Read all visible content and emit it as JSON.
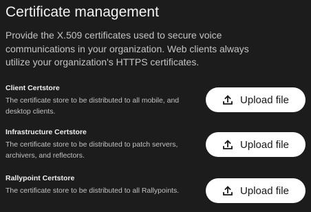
{
  "page": {
    "title": "Certificate management",
    "intro": "Provide the X.509 certificates used to secure voice communications in your organization. Web clients always utilize your organization's HTTPS certificates."
  },
  "sections": [
    {
      "title": "Client Certstore",
      "description": "The certificate store to be distributed to all mobile, and desktop clients.",
      "button_label": "Upload file",
      "button_icon": "upload-icon"
    },
    {
      "title": "Infrastructure Certstore",
      "description": "The certificate store to be distributed to patch servers, archivers, and reflectors.",
      "button_label": "Upload file",
      "button_icon": "upload-icon"
    },
    {
      "title": "Rallypoint Certstore",
      "description": "The certificate store to be distributed to all Rallypoints.",
      "button_label": "Upload file",
      "button_icon": "upload-icon"
    }
  ],
  "colors": {
    "background": "#1c1c1c",
    "button_background": "#ffffff",
    "button_text": "#161616"
  }
}
